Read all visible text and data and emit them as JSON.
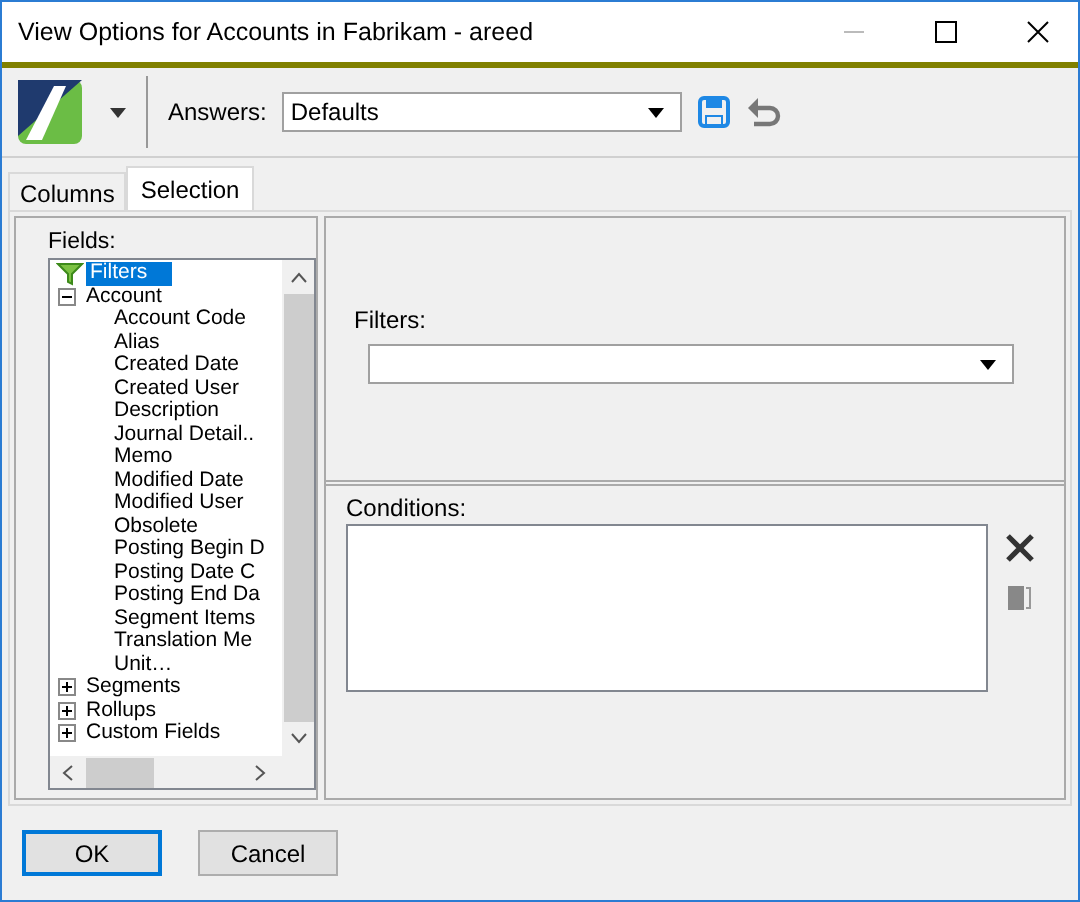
{
  "window": {
    "title": "View Options for Accounts in Fabrikam - areed"
  },
  "toolbar": {
    "answers_label": "Answers:",
    "answers_value": "Defaults"
  },
  "tabs": [
    {
      "label": "Columns",
      "selected": false
    },
    {
      "label": "Selection",
      "selected": true
    }
  ],
  "fields": {
    "label": "Fields:",
    "tree": [
      {
        "label": "Filters",
        "kind": "filter",
        "selected": true
      },
      {
        "label": "Account",
        "kind": "group",
        "expanded": true,
        "selected": false,
        "children": [
          {
            "label": "Account Code",
            "selected": false
          },
          {
            "label": "Alias",
            "selected": false
          },
          {
            "label": "Created Date",
            "selected": false
          },
          {
            "label": "Created User",
            "selected": false
          },
          {
            "label": "Description",
            "selected": false
          },
          {
            "label": "Journal Detail..",
            "selected": false
          },
          {
            "label": "Memo",
            "selected": false
          },
          {
            "label": "Modified Date",
            "selected": false
          },
          {
            "label": "Modified User",
            "selected": false
          },
          {
            "label": "Obsolete",
            "selected": false
          },
          {
            "label": "Posting Begin D",
            "selected": false
          },
          {
            "label": "Posting Date C",
            "selected": false
          },
          {
            "label": "Posting End Da",
            "selected": false
          },
          {
            "label": "Segment Items",
            "selected": false
          },
          {
            "label": "Translation Me",
            "selected": false
          },
          {
            "label": "Unit…",
            "selected": false
          }
        ]
      },
      {
        "label": "Segments",
        "kind": "group",
        "expanded": false,
        "selected": false
      },
      {
        "label": "Rollups",
        "kind": "group",
        "expanded": false,
        "selected": false
      },
      {
        "label": "Custom Fields",
        "kind": "group",
        "expanded": false,
        "selected": false
      }
    ]
  },
  "filters": {
    "label": "Filters:"
  },
  "conditions": {
    "label": "Conditions:"
  },
  "buttons": [
    {
      "label": "OK",
      "default": true
    },
    {
      "label": "Cancel",
      "default": false
    }
  ]
}
